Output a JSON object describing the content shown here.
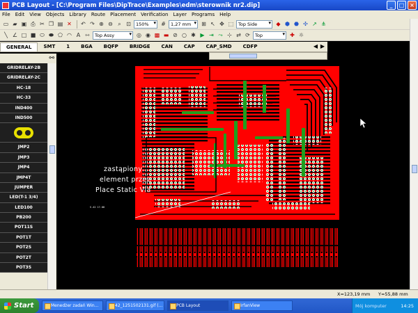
{
  "window": {
    "title": "PCB Layout - [C:\\Program Files\\DipTrace\\Examples\\edm\\sterownik nr2.dip]",
    "buttons": {
      "minimize": "_",
      "maximize": "□",
      "close": "×"
    }
  },
  "menu": [
    "File",
    "Edit",
    "View",
    "Objects",
    "Library",
    "Route",
    "Placement",
    "Verification",
    "Layer",
    "Programs",
    "Help"
  ],
  "toolbar": {
    "zoom": "150%",
    "grid": "1,27 mm",
    "side": "Top Side",
    "assy": "Top Assy",
    "layer": "Top"
  },
  "tabs": [
    "GENERAL",
    "SMT",
    "1",
    "BGA",
    "BQFP",
    "BRIDGE",
    "CAN",
    "CAP",
    "CAP_SMD",
    "CDFP"
  ],
  "sidebar": {
    "items": [
      "GRIDRELAY-2B",
      "GRIDRELAY-2C",
      "HC-18",
      "HC-33",
      "IND400",
      "IND500",
      "",
      "JMP2",
      "JMP3",
      "JMP4",
      "JMP4T",
      "JUMPER",
      "LED(T-1 3/4)",
      "LED100",
      "PB200",
      "POT11S",
      "POT1T",
      "POT2S",
      "POT2T",
      "POT3S"
    ]
  },
  "annotation": {
    "line1": "zastąpiony",
    "line2": "element przez",
    "line3": "Place Static Via",
    "label": "S.42  17.08"
  },
  "status": {
    "x": "X=123,19 mm",
    "y": "Y=55,88 mm"
  },
  "taskbar": {
    "start": "Start",
    "tasks": [
      "Menedżer zadań Win...",
      "42_1251502131.gif (...",
      "PCB Layout",
      "IrfanView"
    ],
    "tray_label": "Mój komputer",
    "clock": "14:25"
  },
  "colors": {
    "copper": "#ff0000",
    "green_pad": "#1ea01e",
    "silk": "#ffffff",
    "board_bg": "#000000"
  }
}
